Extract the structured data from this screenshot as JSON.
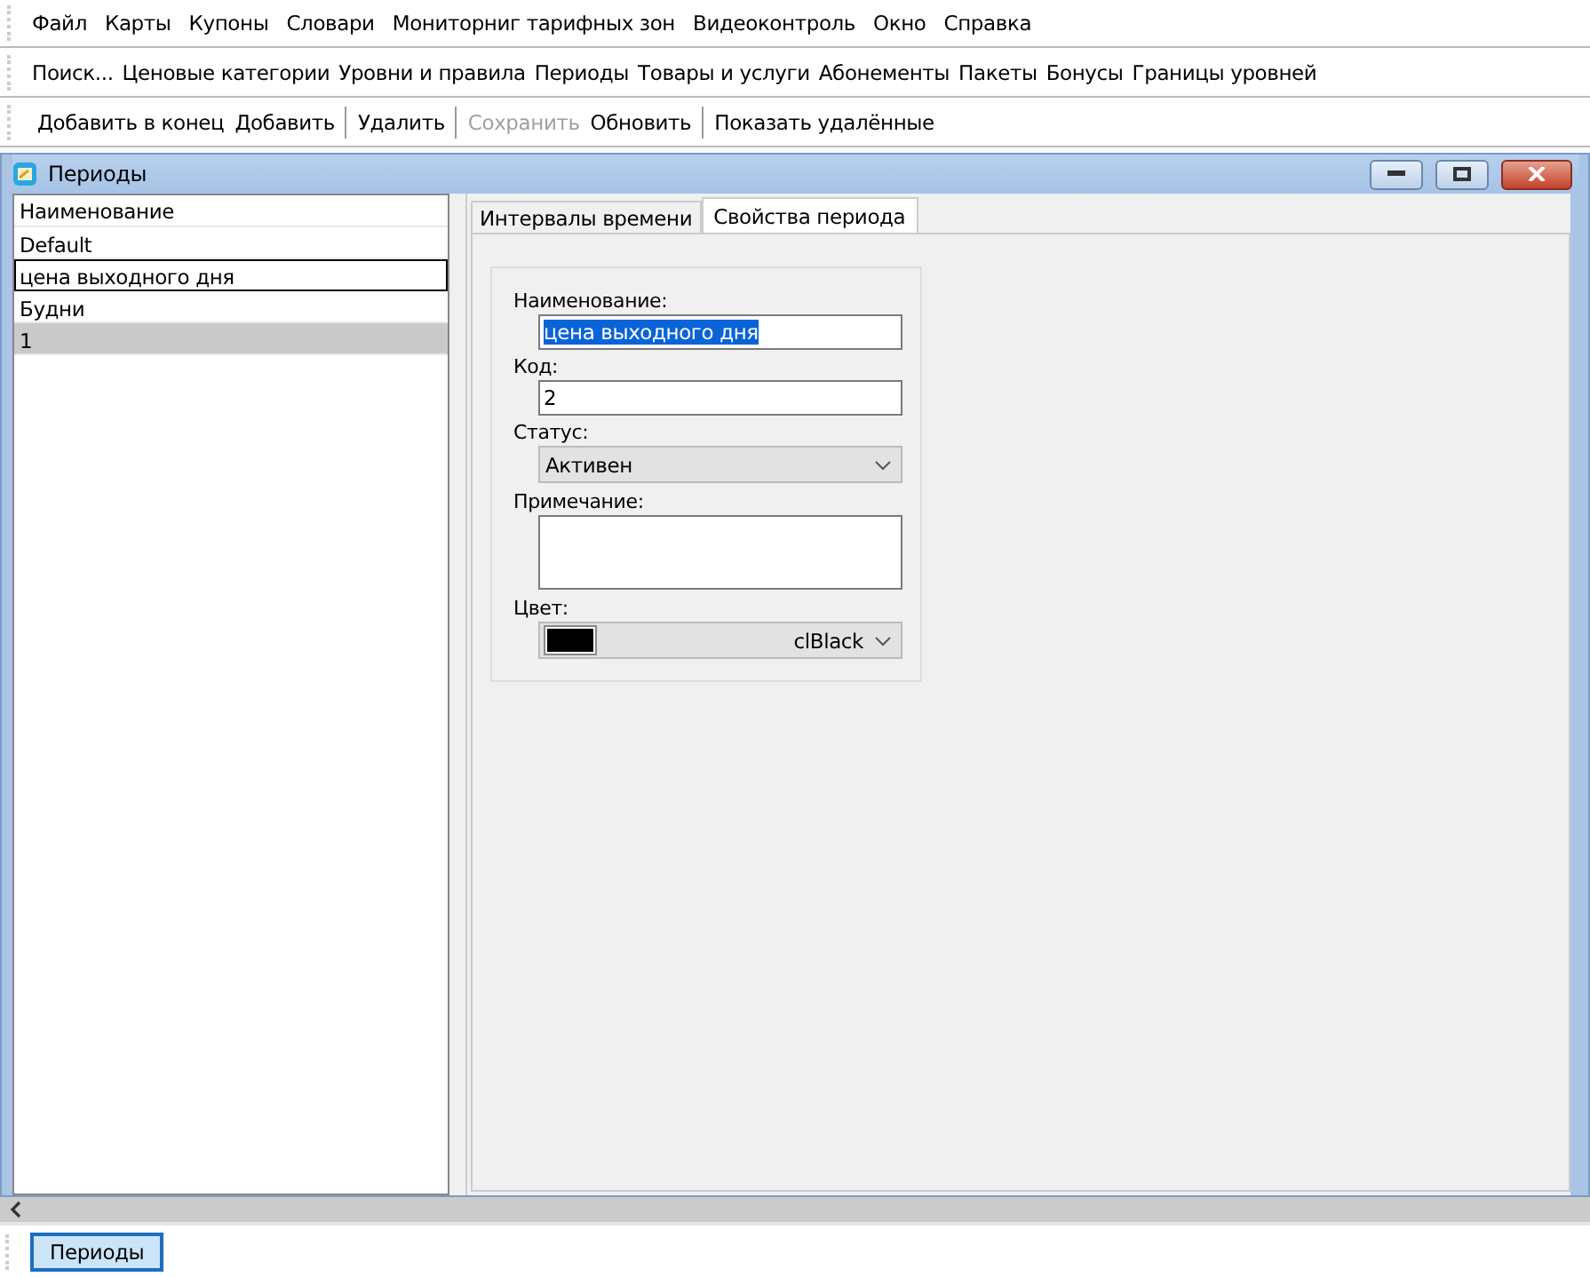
{
  "menu": [
    "Файл",
    "Карты",
    "Купоны",
    "Словари",
    "Мониторниг тарифных зон",
    "Видеоконтроль",
    "Окно",
    "Справка"
  ],
  "nav": [
    "Поиск...",
    "Ценовые категории",
    "Уровни и правила",
    "Периоды",
    "Товары и услуги",
    "Абонементы",
    "Пакеты",
    "Бонусы",
    "Границы уровней"
  ],
  "toolbar": {
    "groups": [
      [
        {
          "label": "Добавить в конец",
          "disabled": false
        },
        {
          "label": "Добавить",
          "disabled": false
        }
      ],
      [
        {
          "label": "Удалить",
          "disabled": false
        }
      ],
      [
        {
          "label": "Сохранить",
          "disabled": true
        },
        {
          "label": "Обновить",
          "disabled": false
        }
      ],
      [
        {
          "label": "Показать удалённые",
          "disabled": false
        }
      ]
    ]
  },
  "window": {
    "title": "Периоды"
  },
  "list": {
    "header": "Наименование",
    "rows": [
      {
        "text": "Default",
        "selected": false,
        "focused": false
      },
      {
        "text": "цена выходного дня",
        "selected": false,
        "focused": true
      },
      {
        "text": "Будни",
        "selected": false,
        "focused": false
      },
      {
        "text": "1",
        "selected": true,
        "focused": false
      }
    ]
  },
  "tabs": [
    {
      "label": "Интервалы времени",
      "selected": false
    },
    {
      "label": "Свойства периода",
      "selected": true
    }
  ],
  "form": [
    {
      "kind": "text",
      "label": "Наименование:",
      "value": "цена выходного дня",
      "highlighted": true
    },
    {
      "kind": "text",
      "label": "Код:",
      "value": "2",
      "highlighted": false
    },
    {
      "kind": "select",
      "label": "Статус:",
      "value": "Активен"
    },
    {
      "kind": "memo",
      "label": "Примечание:"
    },
    {
      "kind": "color",
      "label": "Цвет:",
      "value": "clBlack",
      "color": "#000000"
    }
  ],
  "taskbar": [
    {
      "label": "Периоды",
      "selected": true
    }
  ]
}
